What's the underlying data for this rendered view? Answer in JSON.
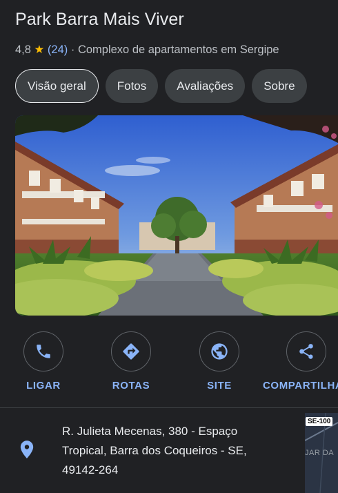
{
  "place": {
    "title": "Park Barra Mais Viver",
    "rating": "4,8",
    "review_count": "(24)",
    "separator": "·",
    "category": "Complexo de apartamentos em Sergipe"
  },
  "tabs": [
    {
      "label": "Visão geral",
      "active": true
    },
    {
      "label": "Fotos",
      "active": false
    },
    {
      "label": "Avaliações",
      "active": false
    },
    {
      "label": "Sobre",
      "active": false
    }
  ],
  "actions": [
    {
      "label": "LIGAR",
      "icon": "phone-icon"
    },
    {
      "label": "ROTAS",
      "icon": "directions-icon"
    },
    {
      "label": "SITE",
      "icon": "globe-icon"
    },
    {
      "label": "COMPARTILHAR",
      "icon": "share-icon"
    }
  ],
  "address": {
    "line1": "R. Julieta Mecenas, 380 - Espaço",
    "line2": "Tropical, Barra dos Coqueiros - SE,",
    "line3": "49142-264",
    "icon": "location-pin-icon"
  },
  "minimap": {
    "shield": "SE-100",
    "road_label": "JAR DA"
  },
  "colors": {
    "background": "#202124",
    "accent": "#8ab4f8",
    "star": "#fbbc04",
    "chip": "#3c4043"
  }
}
